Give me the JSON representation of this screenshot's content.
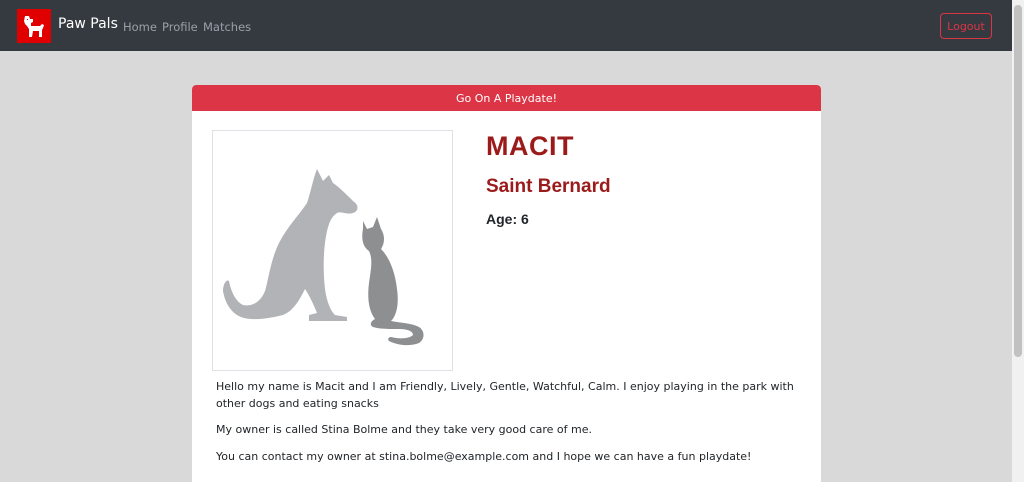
{
  "navbar": {
    "brand": "Paw Pals",
    "logo_icon": "dog-icon",
    "links": [
      "Home",
      "Profile",
      "Matches"
    ],
    "logout_label": "Logout"
  },
  "card": {
    "playdate_label": "Go On A Playdate!",
    "image_icon": "dog-and-cat-icon",
    "name": "MACIT",
    "breed": "Saint Bernard",
    "age": "Age: 6",
    "bio_intro": "Hello my name is Macit and I am Friendly, Lively, Gentle, Watchful, Calm. I enjoy playing in the park with other dogs and eating snacks",
    "bio_owner": "My owner is called Stina Bolme and they take very good care of me.",
    "bio_contact": "You can contact my owner at stina.bolme@example.com and I hope we can have a fun playdate!"
  },
  "colors": {
    "navbar": "#343a40",
    "accent": "#dc3545",
    "title": "#9b1a1a",
    "logo_bg": "#e00000"
  }
}
